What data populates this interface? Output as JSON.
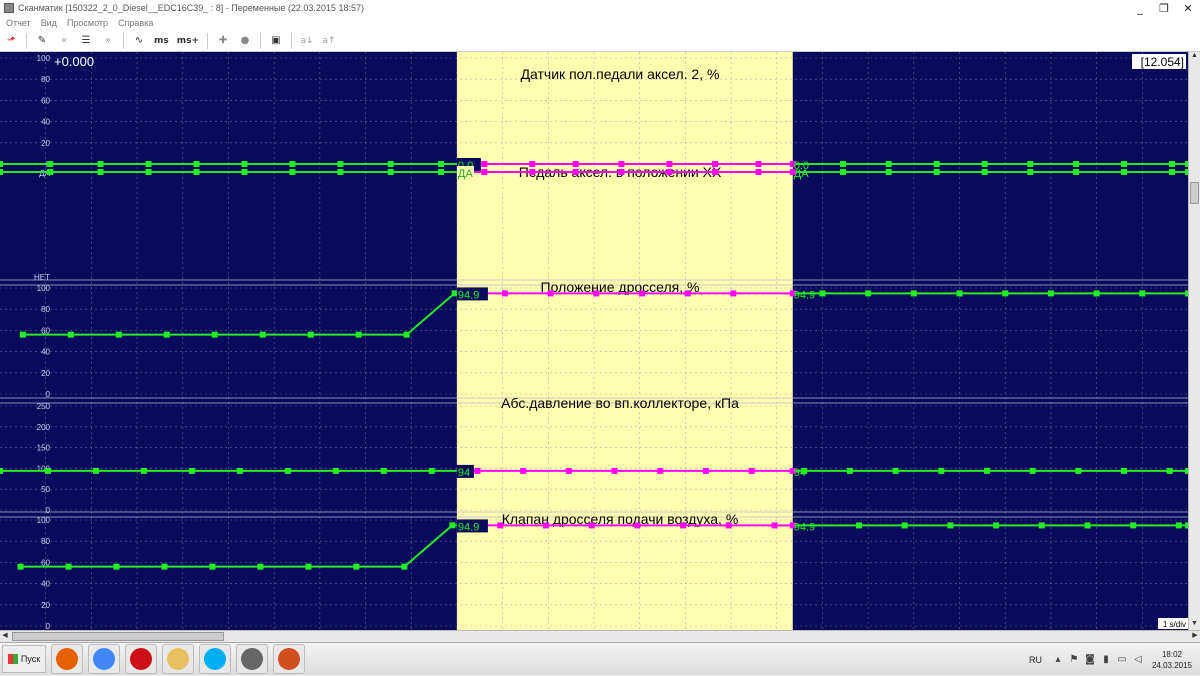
{
  "window": {
    "title": "Сканматик [150322_2_0_Diesel__EDC16C39_ : 8] - Переменные (22.03.2015  18:57)",
    "minimize": "_",
    "restore": "❐",
    "close": "✕"
  },
  "menu": [
    "Отчет",
    "Вид",
    "Просмотр",
    "Справка"
  ],
  "toolbar": {
    "ms_label": "ms",
    "ms_plus_label": "ms+",
    "a_minus": "a↓",
    "a_plus": "a↑"
  },
  "chart": {
    "readout_left": "+0.000",
    "readout_right": "[12.054]",
    "scale": "1 s/div",
    "colors": {
      "background": "#0a0a5c",
      "selection": "#ffffb0",
      "trace": "#22ee22",
      "trace_selected": "#ff00ff",
      "grid": "#8a8ab4"
    },
    "selection_x": [
      10.0,
      17.35
    ],
    "time_range": [
      0,
      26
    ],
    "panels": [
      {
        "title": "Датчик пол.педали аксел. 2, %",
        "yticks": [
          "100",
          "80",
          "60",
          "40",
          "20",
          "0"
        ],
        "y_range": [
          0,
          100
        ],
        "series": [
          {
            "values": [
              [
                0,
                0
              ],
              [
                1.1,
                0
              ],
              [
                2.2,
                0
              ],
              [
                3.25,
                0
              ],
              [
                4.3,
                0
              ],
              [
                5.35,
                0
              ],
              [
                6.4,
                0
              ],
              [
                7.45,
                0
              ],
              [
                8.55,
                0
              ],
              [
                9.65,
                0
              ],
              [
                10.6,
                0
              ],
              [
                11.65,
                0
              ],
              [
                12.6,
                0
              ],
              [
                13.6,
                0
              ],
              [
                14.65,
                0
              ],
              [
                15.65,
                0
              ],
              [
                16.6,
                0
              ],
              [
                17.35,
                0
              ],
              [
                18.45,
                0
              ],
              [
                19.45,
                0
              ],
              [
                20.5,
                0
              ],
              [
                21.55,
                0
              ],
              [
                22.55,
                0
              ],
              [
                23.55,
                0
              ],
              [
                24.6,
                0
              ],
              [
                25.65,
                0
              ],
              [
                26,
                0
              ]
            ],
            "readout_sel": "0.0",
            "readout_right": "0.0"
          }
        ]
      },
      {
        "title": "Педаль аксел. в положении ХХ",
        "yticks": [
          "ДА"
        ],
        "y_range": [
          0,
          1
        ],
        "bottom_tick": "НЕТ",
        "series": [
          {
            "values": [
              [
                0,
                1
              ],
              [
                1.1,
                1
              ],
              [
                2.2,
                1
              ],
              [
                3.25,
                1
              ],
              [
                4.3,
                1
              ],
              [
                5.35,
                1
              ],
              [
                6.4,
                1
              ],
              [
                7.45,
                1
              ],
              [
                8.55,
                1
              ],
              [
                9.65,
                1
              ],
              [
                10.6,
                1
              ],
              [
                11.65,
                1
              ],
              [
                12.6,
                1
              ],
              [
                13.6,
                1
              ],
              [
                14.65,
                1
              ],
              [
                15.65,
                1
              ],
              [
                16.6,
                1
              ],
              [
                17.35,
                1
              ],
              [
                18.45,
                1
              ],
              [
                19.45,
                1
              ],
              [
                20.5,
                1
              ],
              [
                21.55,
                1
              ],
              [
                22.55,
                1
              ],
              [
                23.55,
                1
              ],
              [
                24.6,
                1
              ],
              [
                25.65,
                1
              ],
              [
                26,
                1
              ]
            ],
            "readout_sel": "ДА",
            "readout_right": "ДА"
          }
        ]
      },
      {
        "title": "Положение дросселя, %",
        "yticks": [
          "100",
          "80",
          "60",
          "40",
          "20",
          "0"
        ],
        "y_range": [
          0,
          100
        ],
        "series": [
          {
            "values": [
              [
                0.5,
                56
              ],
              [
                1.55,
                56
              ],
              [
                2.6,
                56
              ],
              [
                3.65,
                56
              ],
              [
                4.7,
                56
              ],
              [
                5.75,
                56
              ],
              [
                6.8,
                56
              ],
              [
                7.85,
                56
              ],
              [
                8.9,
                56
              ],
              [
                9.95,
                95
              ],
              [
                10.6,
                94.9
              ],
              [
                11.05,
                94.9
              ],
              [
                12.05,
                94.9
              ],
              [
                13.05,
                94.9
              ],
              [
                14.05,
                94.9
              ],
              [
                15.05,
                94.9
              ],
              [
                16.05,
                94.9
              ],
              [
                17.35,
                94.9
              ],
              [
                18.0,
                94.9
              ],
              [
                19.0,
                94.9
              ],
              [
                20.0,
                94.9
              ],
              [
                21.0,
                94.9
              ],
              [
                22.0,
                94.9
              ],
              [
                23.0,
                94.9
              ],
              [
                24.0,
                94.9
              ],
              [
                25.0,
                94.9
              ],
              [
                26,
                94.9
              ]
            ],
            "readout_sel": "94.9",
            "readout_right": "94.9"
          }
        ]
      },
      {
        "title": "Абс.давление во вп.коллекторе, кПа",
        "yticks": [
          "250",
          "200",
          "150",
          "100",
          "50",
          "0"
        ],
        "y_range": [
          0,
          250
        ],
        "series": [
          {
            "values": [
              [
                0,
                94
              ],
              [
                1.05,
                94
              ],
              [
                2.1,
                94
              ],
              [
                3.15,
                94
              ],
              [
                4.2,
                94
              ],
              [
                5.25,
                94
              ],
              [
                6.3,
                94
              ],
              [
                7.35,
                94
              ],
              [
                8.4,
                94
              ],
              [
                9.45,
                94
              ],
              [
                10.45,
                94
              ],
              [
                11.45,
                94
              ],
              [
                12.45,
                94
              ],
              [
                13.45,
                94
              ],
              [
                14.45,
                94
              ],
              [
                15.45,
                94
              ],
              [
                16.45,
                94
              ],
              [
                17.35,
                94
              ],
              [
                17.6,
                94
              ],
              [
                18.6,
                94
              ],
              [
                19.6,
                94
              ],
              [
                20.6,
                94
              ],
              [
                21.6,
                94
              ],
              [
                22.6,
                94
              ],
              [
                23.6,
                94
              ],
              [
                24.6,
                94
              ],
              [
                25.6,
                94
              ],
              [
                26,
                94
              ]
            ],
            "readout_sel": "94",
            "readout_right": "94"
          }
        ]
      },
      {
        "title": "Клапан дросселя подачи воздуха, %",
        "yticks": [
          "100",
          "80",
          "60",
          "40",
          "20",
          "0"
        ],
        "y_range": [
          0,
          100
        ],
        "series": [
          {
            "values": [
              [
                0.45,
                56
              ],
              [
                1.5,
                56
              ],
              [
                2.55,
                56
              ],
              [
                3.6,
                56
              ],
              [
                4.65,
                56
              ],
              [
                5.7,
                56
              ],
              [
                6.75,
                56
              ],
              [
                7.8,
                56
              ],
              [
                8.85,
                56
              ],
              [
                9.9,
                95
              ],
              [
                10.95,
                94.9
              ],
              [
                11.95,
                94.9
              ],
              [
                12.95,
                94.9
              ],
              [
                13.95,
                94.9
              ],
              [
                14.95,
                94.9
              ],
              [
                15.95,
                94.9
              ],
              [
                16.95,
                94.9
              ],
              [
                17.35,
                94.9
              ],
              [
                18.8,
                94.9
              ],
              [
                19.8,
                94.9
              ],
              [
                20.8,
                94.9
              ],
              [
                21.8,
                94.9
              ],
              [
                22.8,
                94.9
              ],
              [
                23.8,
                94.9
              ],
              [
                24.8,
                94.9
              ],
              [
                25.8,
                94.9
              ],
              [
                26,
                94.9
              ]
            ],
            "readout_sel": "94.9",
            "readout_right": "94.9"
          }
        ]
      }
    ]
  },
  "taskbar": {
    "start_label": "Пуск",
    "apps": [
      {
        "name": "firefox-icon",
        "color": "#e66000"
      },
      {
        "name": "chrome-icon",
        "color": "#4285f4"
      },
      {
        "name": "opera-icon",
        "color": "#cc0f16"
      },
      {
        "name": "folder-icon",
        "color": "#e8c060"
      },
      {
        "name": "skype-icon",
        "color": "#00aff0"
      },
      {
        "name": "app-icon",
        "color": "#666666"
      },
      {
        "name": "scanmatik-icon",
        "color": "#d05020"
      }
    ],
    "lang": "RU",
    "time": "18:02",
    "date": "24.03.2015"
  }
}
